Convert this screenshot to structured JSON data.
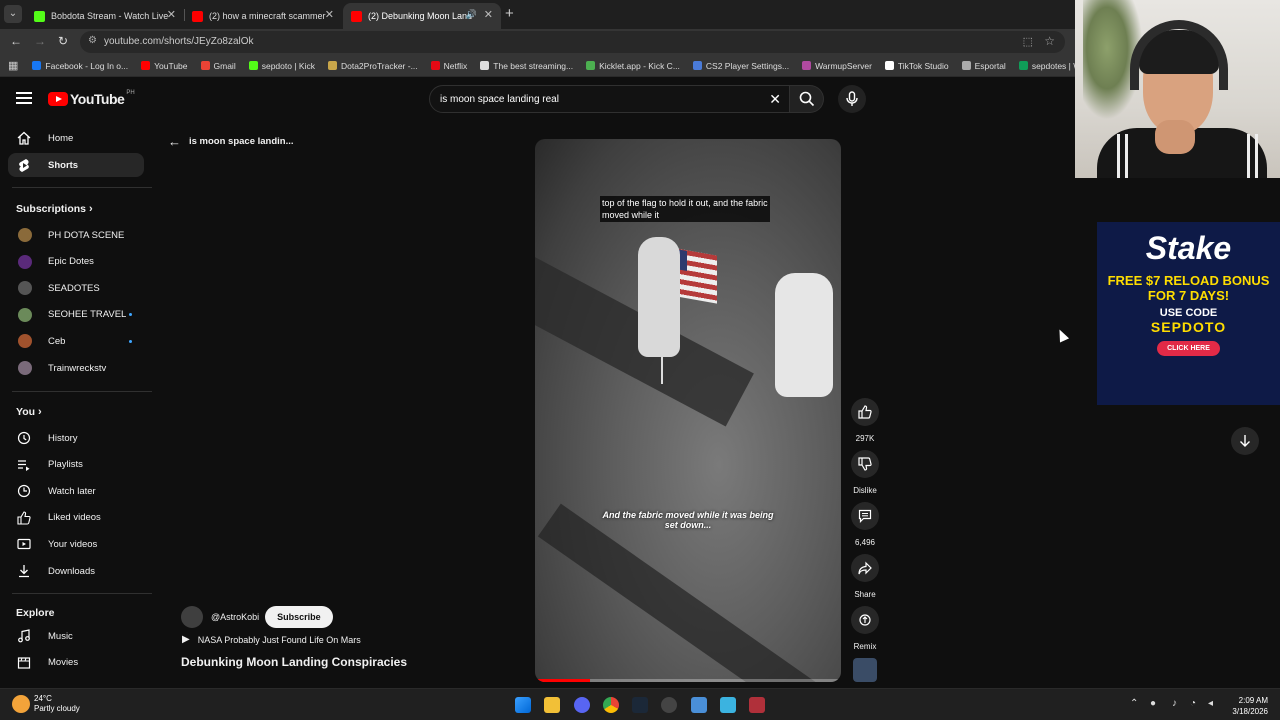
{
  "browser": {
    "tabs": [
      {
        "title": "Bobdota Stream - Watch Live o",
        "color": "#53fc18"
      },
      {
        "title": "(2) how a minecraft scammer st",
        "color": "#ff0000"
      },
      {
        "title": "(2) Debunking Moon Landi",
        "color": "#ff0000"
      }
    ],
    "url": "youtube.com/shorts/JEyZo8zalOk",
    "bookmarks": [
      {
        "label": "Facebook - Log In o...",
        "color": "#1877f2"
      },
      {
        "label": "YouTube",
        "color": "#ff0000"
      },
      {
        "label": "Gmail",
        "color": "#ea4335"
      },
      {
        "label": "sepdoto | Kick",
        "color": "#53fc18"
      },
      {
        "label": "Dota2ProTracker -...",
        "color": "#c8a64a"
      },
      {
        "label": "Netflix",
        "color": "#e50914"
      },
      {
        "label": "The best streaming...",
        "color": "#dddddd"
      },
      {
        "label": "Kicklet.app - Kick C...",
        "color": "#4caf50"
      },
      {
        "label": "CS2 Player Settings...",
        "color": "#4a7bd8"
      },
      {
        "label": "WarmupServer",
        "color": "#b04aa0"
      },
      {
        "label": "TikTok Studio",
        "color": "#ffffff"
      },
      {
        "label": "Esportal",
        "color": "#aaaaaa"
      },
      {
        "label": "sepdotes | Weighte...",
        "color": "#0f9d58"
      }
    ]
  },
  "youtube": {
    "logo_text": "YouTube",
    "country": "PH",
    "search_query": "is moon space landing real"
  },
  "sidebar": {
    "main": [
      {
        "label": "Home",
        "icon": "home-icon"
      },
      {
        "label": "Shorts",
        "icon": "shorts-icon"
      }
    ],
    "subscriptions_heading": "Subscriptions",
    "subscriptions": [
      {
        "label": "PH DOTA SCENE",
        "color": "#8a6a3a",
        "dot": false
      },
      {
        "label": "Epic Dotes",
        "color": "#5a2a7a",
        "dot": false
      },
      {
        "label": "SEADOTES",
        "color": "#555555",
        "dot": false
      },
      {
        "label": "SEOHEE TRAVEL",
        "color": "#6b8a5a",
        "dot": true
      },
      {
        "label": "Ceb",
        "color": "#a0522d",
        "dot": true
      },
      {
        "label": "Trainwreckstv",
        "color": "#7a6a7a",
        "dot": false
      }
    ],
    "you_heading": "You",
    "you": [
      {
        "label": "History",
        "icon": "history-icon"
      },
      {
        "label": "Playlists",
        "icon": "playlists-icon"
      },
      {
        "label": "Watch later",
        "icon": "clock-icon"
      },
      {
        "label": "Liked videos",
        "icon": "thumbs-up-icon"
      },
      {
        "label": "Your videos",
        "icon": "video-icon"
      },
      {
        "label": "Downloads",
        "icon": "download-icon"
      }
    ],
    "explore_heading": "Explore",
    "explore": [
      {
        "label": "Music",
        "icon": "music-icon"
      },
      {
        "label": "Movies",
        "icon": "movies-icon"
      }
    ]
  },
  "short": {
    "back_title": "is moon space landin...",
    "caption_top": "top of the flag to hold it out, and the fabric moved while it",
    "caption_bottom": "And the fabric moved while it was being set down...",
    "likes": "297K",
    "dislike_label": "Dislike",
    "comments": "6,496",
    "share_label": "Share",
    "remix_label": "Remix",
    "channel": "@AstroKobi",
    "subscribe_label": "Subscribe",
    "related": "NASA Probably Just Found Life On Mars",
    "title": "Debunking Moon Landing Conspiracies"
  },
  "ad": {
    "brand": "Stake",
    "line1": "FREE $7 RELOAD BONUS FOR 7 DAYS!",
    "line2": "USE CODE",
    "code": "SEPDOTO",
    "cta": "CLICK HERE"
  },
  "taskbar": {
    "temperature": "24°C",
    "weather": "Partly cloudy",
    "time": "2:09 AM",
    "date": "3/18/2026"
  }
}
